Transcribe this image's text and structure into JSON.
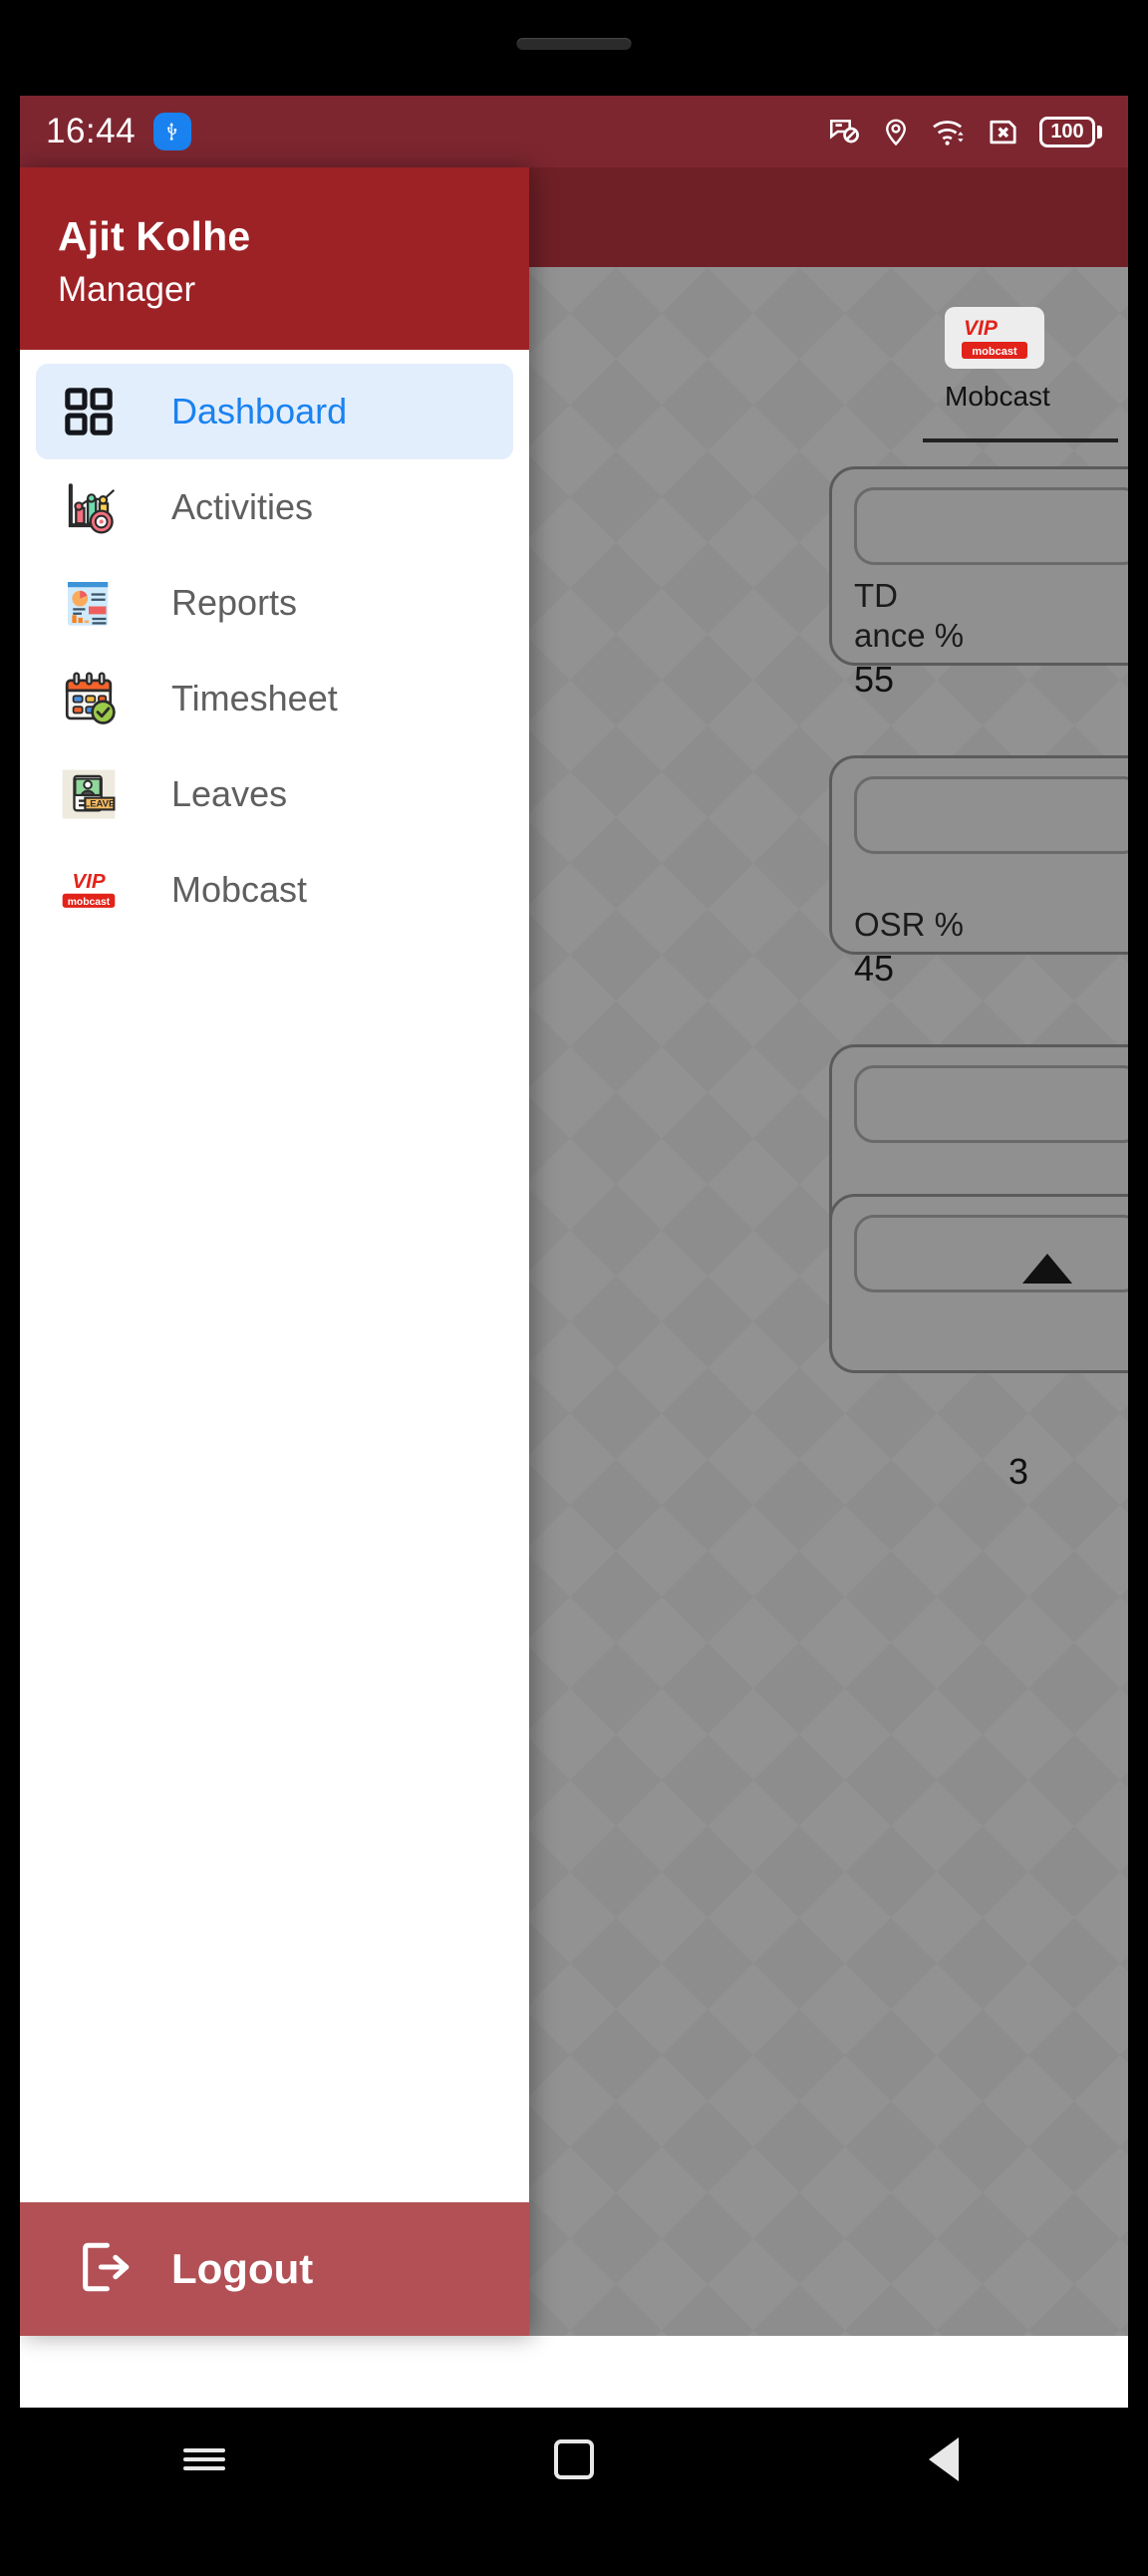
{
  "status_bar": {
    "time": "16:44",
    "usb_icon": "usb-icon",
    "icons": [
      "notification-muted-icon",
      "location-pin-icon",
      "wifi-icon",
      "sim-card-disabled-icon"
    ],
    "battery_level": "100",
    "background": "#7d2630"
  },
  "drawer": {
    "user_name": "Ajit Kolhe",
    "user_role": "Manager",
    "header_color": "#9d2226",
    "active_color": "#1a82f0",
    "active_bg": "#e3eefc",
    "items": [
      {
        "label": "Dashboard",
        "icon": "grid-squares-icon",
        "active": true
      },
      {
        "label": "Activities",
        "icon": "bar-chart-target-icon",
        "active": false
      },
      {
        "label": "Reports",
        "icon": "report-document-icon",
        "active": false
      },
      {
        "label": "Timesheet",
        "icon": "calendar-check-icon",
        "active": false
      },
      {
        "label": "Leaves",
        "icon": "leave-badge-icon",
        "active": false
      },
      {
        "label": "Mobcast",
        "icon": "vip-mobcast-logo-icon",
        "active": false
      }
    ],
    "logout_label": "Logout",
    "logout_icon": "logout-arrow-icon",
    "logout_color": "#b25055"
  },
  "background_app": {
    "brand_title": "Mobcast",
    "brand_logo": "vip-mobcast-logo-icon",
    "cards": [
      {
        "line1": "TD",
        "line2": "ance %",
        "value": "55"
      },
      {
        "line1": "",
        "line2": "OSR %",
        "value": "45"
      },
      {
        "line1": "",
        "line2": "",
        "value": ""
      }
    ],
    "arrow_icon": "triangle-up-icon",
    "trailing_number": "3"
  },
  "nav_bar": {
    "recents": "recents-icon",
    "home": "home-square-icon",
    "back": "back-triangle-icon"
  }
}
